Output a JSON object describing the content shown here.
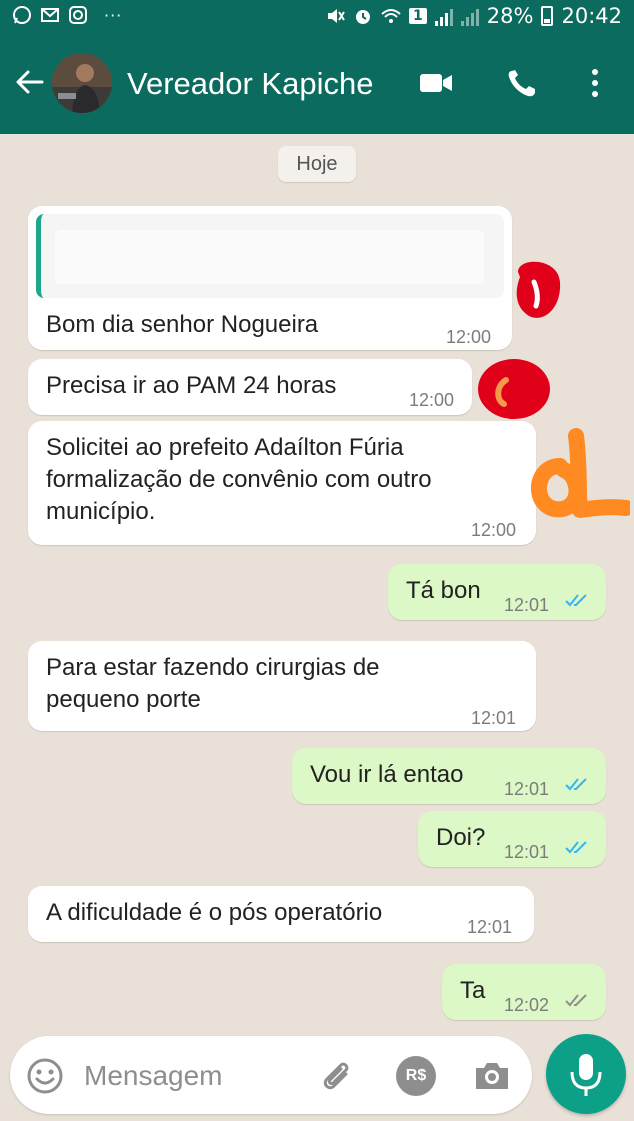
{
  "status_bar": {
    "battery_percent": "28%",
    "time": "20:42",
    "sim_label": "1",
    "dots": "···"
  },
  "header": {
    "contact_name": "Vereador Kapiche"
  },
  "chat": {
    "day_label": "Hoje",
    "messages": [
      {
        "dir": "in",
        "text": "Bom dia senhor Nogueira",
        "time": "12:00"
      },
      {
        "dir": "in",
        "text": "Precisa ir ao PAM 24 horas",
        "time": "12:00"
      },
      {
        "dir": "in",
        "line1": "Solicitei ao prefeito Adaílton Fúria",
        "line2": "formalização de convênio com outro",
        "line3": "município.",
        "time": "12:00"
      },
      {
        "dir": "out",
        "text": "Tá bon",
        "time": "12:01",
        "read": true
      },
      {
        "dir": "in",
        "line1": "Para estar fazendo cirurgias de",
        "line2": "pequeno porte",
        "time": "12:01"
      },
      {
        "dir": "out",
        "text": "Vou ir lá entao",
        "time": "12:01",
        "read": true
      },
      {
        "dir": "out",
        "text": "Doi?",
        "time": "12:01",
        "read": true
      },
      {
        "dir": "in",
        "text": "A dificuldade é o pós operatório",
        "time": "12:01"
      },
      {
        "dir": "out",
        "text": "Ta",
        "time": "12:02",
        "read": false
      }
    ]
  },
  "composer": {
    "placeholder": "Mensagem",
    "pay_label": "R$"
  },
  "colors": {
    "header": "#0b6b5e",
    "outgoing_bubble": "#dcf8c6",
    "incoming_bubble": "#ffffff",
    "read_ticks": "#34b7f1",
    "sent_ticks": "#8e8e8e",
    "mic_button": "#0ca088"
  }
}
